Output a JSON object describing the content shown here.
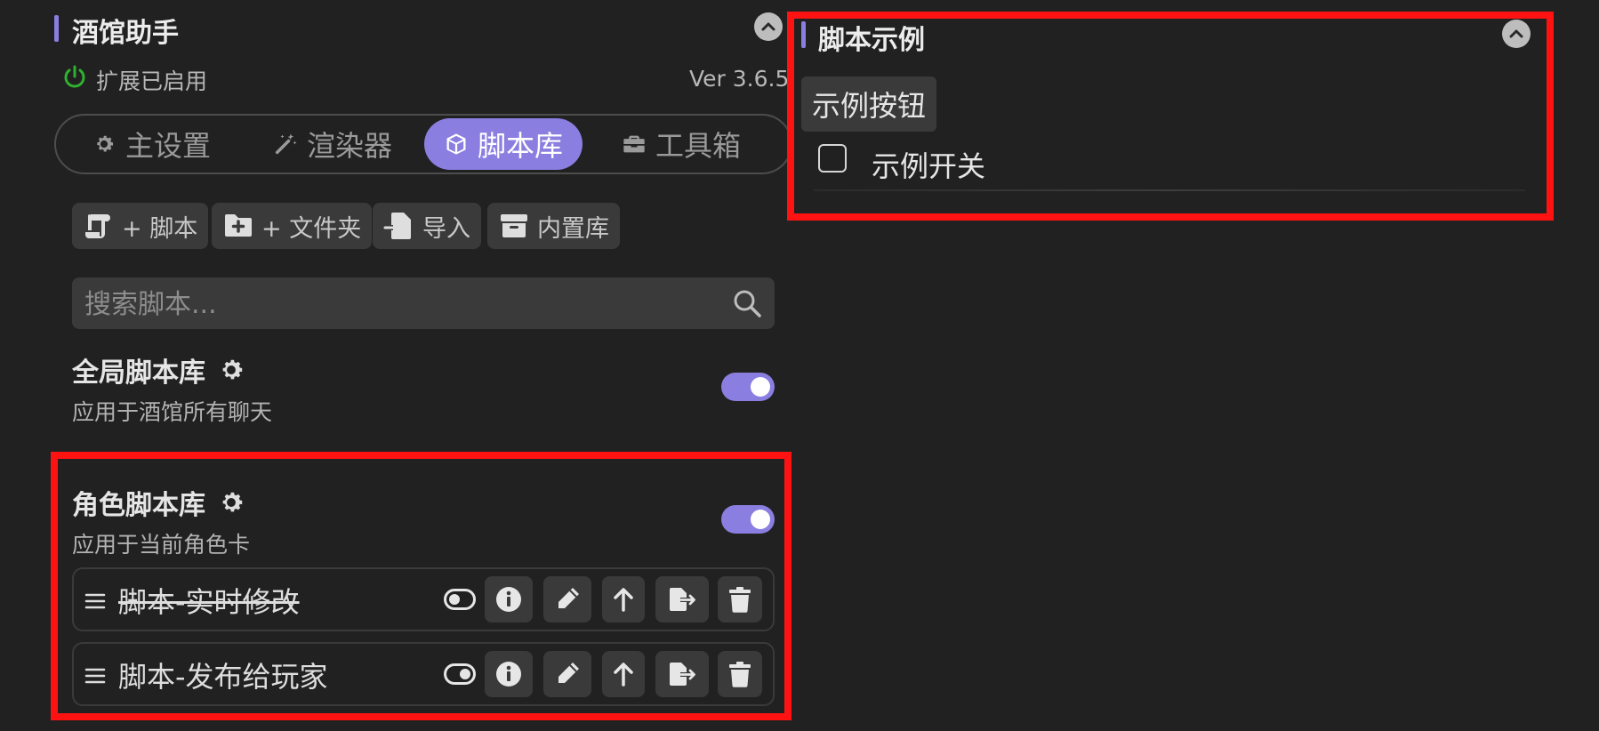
{
  "left_panel": {
    "title": "酒馆助手",
    "status_text": "扩展已启用",
    "version": "Ver 3.6.5",
    "tabs": [
      {
        "label": "主设置",
        "icon": "gear-icon",
        "active": false
      },
      {
        "label": "渲染器",
        "icon": "magic-wand-icon",
        "active": false
      },
      {
        "label": "脚本库",
        "icon": "cube-icon",
        "active": true
      },
      {
        "label": "工具箱",
        "icon": "toolbox-icon",
        "active": false
      }
    ],
    "actions": [
      {
        "label": "+ 脚本",
        "icon": "scroll-icon"
      },
      {
        "label": "+ 文件夹",
        "icon": "folder-plus-icon"
      },
      {
        "label": "导入",
        "icon": "file-import-icon"
      },
      {
        "label": "内置库",
        "icon": "archive-icon"
      }
    ],
    "search": {
      "placeholder": "搜索脚本..."
    },
    "global_library": {
      "title": "全局脚本库",
      "subtitle": "应用于酒馆所有聊天",
      "enabled": true
    },
    "character_library": {
      "title": "角色脚本库",
      "subtitle": "应用于当前角色卡",
      "enabled": true,
      "scripts": [
        {
          "name": "脚本-实时修改",
          "enabled": false
        },
        {
          "name": "脚本-发布给玩家",
          "enabled": true
        }
      ]
    }
  },
  "right_panel": {
    "title": "脚本示例",
    "button_label": "示例按钮",
    "toggle_label": "示例开关"
  },
  "colors": {
    "background": "#212121",
    "accent": "#8a7ee0",
    "highlight": "#ff1212",
    "button": "#3a3a3a",
    "status_green": "#2fb12f"
  }
}
